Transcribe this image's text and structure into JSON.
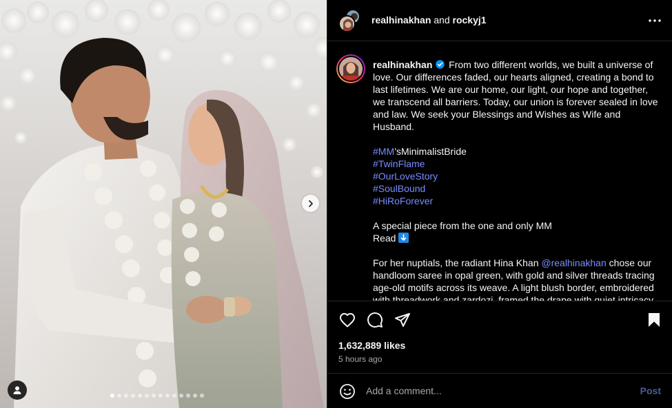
{
  "header": {
    "user1": "realhinakhan",
    "joiner": "and",
    "user2": "rockyj1"
  },
  "caption": {
    "username": "realhinakhan",
    "body": "From two different worlds, we built a universe of love. Our differences faded, our hearts aligned, creating a bond to last lifetimes. We are our home, our light, our hope and together, we transcend all barriers. Today, our union is forever sealed in love and law. We seek your Blessings and Wishes as Wife and Husband.",
    "hashtag_1_tag": "#MM",
    "hashtag_1_suffix": "’sMinimalistBride",
    "hashtags": [
      "#TwinFlame",
      "#OurLoveStory",
      "#SoulBound",
      "#HiRoForever"
    ],
    "special_line": "A special piece from the one and only MM",
    "read_label": "Read",
    "nuptials_before": "For her nuptials, the radiant Hina Khan ",
    "nuptials_mention": "@realhinakhan",
    "nuptials_after": " chose our handloom saree in opal green, with gold and silver threads tracing age-old motifs across its weave. A light blush border, embroidered with threadwork and zardozi, framed the drape with quiet intricacy."
  },
  "stats": {
    "likes": "1,632,889 likes",
    "time": "5 hours ago"
  },
  "comment": {
    "placeholder": "Add a comment...",
    "post_label": "Post"
  },
  "carousel": {
    "total": 14,
    "active_index": 0
  },
  "icons": {
    "verified": "verified-badge-icon",
    "more": "more-options-icon",
    "like": "heart-icon",
    "comment": "comment-bubble-icon",
    "share": "paper-plane-icon",
    "save": "bookmark-icon",
    "emoji": "emoji-smiley-icon",
    "next": "chevron-right-icon",
    "tag": "user-tag-icon",
    "read_arrow": "down-arrow-emoji-icon"
  },
  "colors": {
    "link": "#7b8cff",
    "post_button": "#4a5d9b",
    "background": "#000000",
    "verified": "#0095f6"
  }
}
